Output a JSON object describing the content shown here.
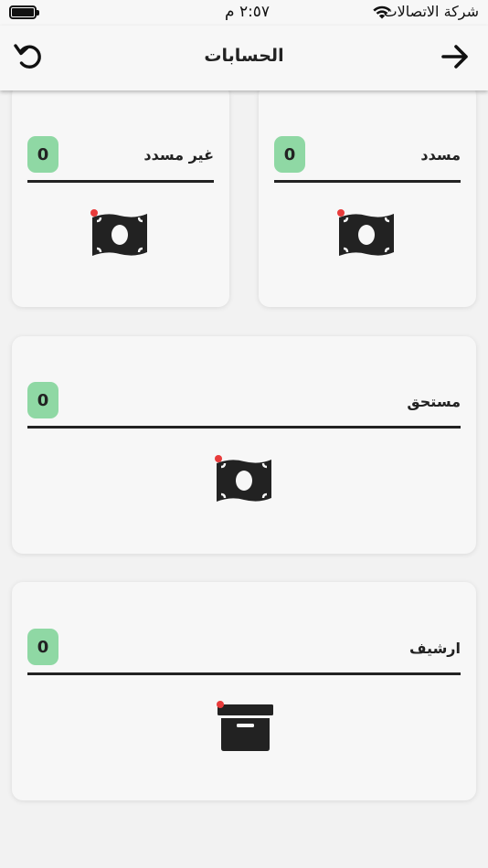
{
  "status_bar": {
    "time": "٢:٥٧ م",
    "carrier": "شركة الاتصالات",
    "battery_icon": "battery-full-icon",
    "wifi_icon": "wifi-icon"
  },
  "nav": {
    "title": "الحسابات",
    "refresh_icon": "refresh-icon",
    "back_icon": "arrow-right-icon"
  },
  "cards": [
    {
      "title": "مسدد",
      "count": "0",
      "icon": "money-bill-icon"
    },
    {
      "title": "غير مسدد",
      "count": "0",
      "icon": "money-bill-icon"
    },
    {
      "title": "مستحق",
      "count": "0",
      "icon": "money-bill-icon"
    },
    {
      "title": "ارشيف",
      "count": "0",
      "icon": "archive-box-icon"
    }
  ],
  "colors": {
    "badge": "#8fd8a4",
    "notification_dot": "#e83b3b",
    "icon": "#222222",
    "card_bg": "#f7f7f7",
    "page_bg": "#f2f2f2"
  }
}
